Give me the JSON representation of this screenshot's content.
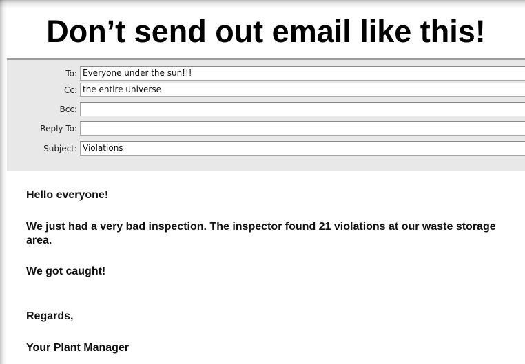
{
  "headline": "Don’t send out email like this!",
  "email": {
    "headers": [
      {
        "label": "To:",
        "value": "Everyone under the sun!!!"
      },
      {
        "label": "Cc:",
        "value": "the entire universe"
      },
      {
        "label": "Bcc:",
        "value": ""
      },
      {
        "label": "Reply To:",
        "value": ""
      },
      {
        "label": "Subject:",
        "value": "Violations"
      }
    ],
    "body": {
      "greeting": "Hello everyone!",
      "paragraph": "We just had a very bad inspection. The inspector found 21 violations at our waste storage area.",
      "caught": "We got caught!",
      "closing": "Regards,",
      "signature": "Your Plant Manager"
    }
  }
}
